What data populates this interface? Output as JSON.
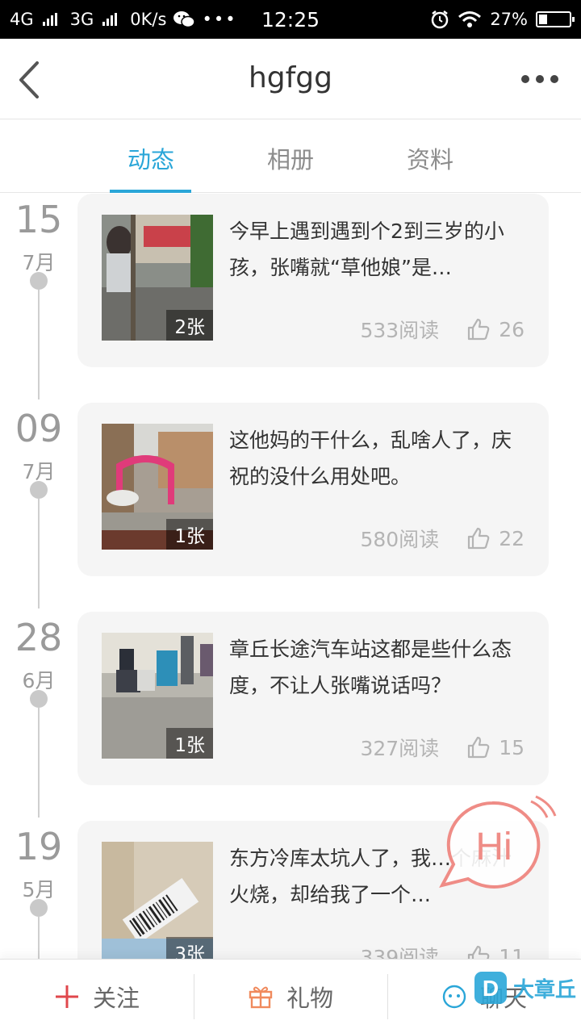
{
  "status_bar": {
    "network1": "4G",
    "network2": "3G",
    "speed": "0K/s",
    "time": "12:25",
    "battery": "27%",
    "battery_level": 0.27
  },
  "header": {
    "title": "hgfgg"
  },
  "tabs": [
    {
      "label": "动态",
      "active": true
    },
    {
      "label": "相册",
      "active": false
    },
    {
      "label": "资料",
      "active": false
    }
  ],
  "posts": [
    {
      "day": "15",
      "month": "7月",
      "text": "今早上遇到遇到个2到三岁的小孩，张嘴就“草他娘”是…",
      "photos": "2张",
      "reads": "533阅读",
      "likes": "26"
    },
    {
      "day": "09",
      "month": "7月",
      "text": "这他妈的干什么，乱啥人了，庆祝的没什么用处吧。",
      "photos": "1张",
      "reads": "580阅读",
      "likes": "22"
    },
    {
      "day": "28",
      "month": "6月",
      "text": "章丘长途汽车站这都是些什么态度，不让人张嘴说话吗？",
      "photos": "1张",
      "reads": "327阅读",
      "likes": "15"
    },
    {
      "day": "19",
      "month": "5月",
      "text": "东方冷库太坑人了，我…个麻汁火烧，却给我了一个…",
      "photos": "3张",
      "reads": "339阅读",
      "likes": "11"
    }
  ],
  "hi_bubble": {
    "label": "Hi"
  },
  "bottom_bar": {
    "follow": "关注",
    "gift": "礼物",
    "chat": "聊天"
  },
  "watermark": {
    "text": "大章丘"
  },
  "colors": {
    "accent": "#2aa6d8",
    "follow_plus": "#e0474c",
    "gift": "#f08a5d",
    "hi": "#ef8c86"
  }
}
